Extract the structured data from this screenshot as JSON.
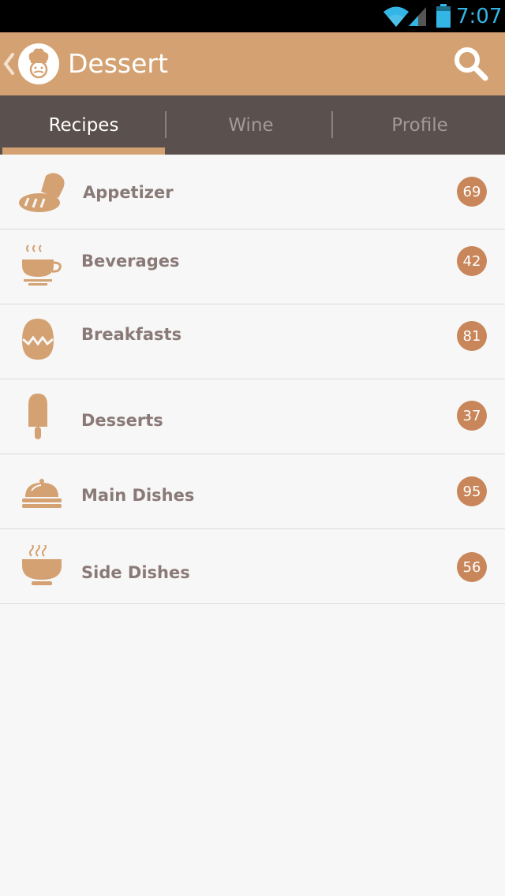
{
  "status_bar": {
    "time": "7:07"
  },
  "app_bar": {
    "title": "Dessert"
  },
  "tabs": [
    {
      "label": "Recipes",
      "active": true
    },
    {
      "label": "Wine",
      "active": false
    },
    {
      "label": "Profile",
      "active": false
    }
  ],
  "categories": [
    {
      "label": "Appetizer",
      "count": "69",
      "icon": "bread-icon"
    },
    {
      "label": "Beverages",
      "count": "42",
      "icon": "coffee-cup-icon"
    },
    {
      "label": "Breakfasts",
      "count": "81",
      "icon": "egg-icon"
    },
    {
      "label": "Desserts",
      "count": "37",
      "icon": "popsicle-icon"
    },
    {
      "label": "Main Dishes",
      "count": "95",
      "icon": "cloche-icon"
    },
    {
      "label": "Side Dishes",
      "count": "56",
      "icon": "soup-bowl-icon"
    }
  ],
  "colors": {
    "app_bar": "#d4a272",
    "tabs_bg": "#5a504d",
    "badge": "#c8865a",
    "icon": "#d4a272",
    "clock": "#33b5e5"
  }
}
